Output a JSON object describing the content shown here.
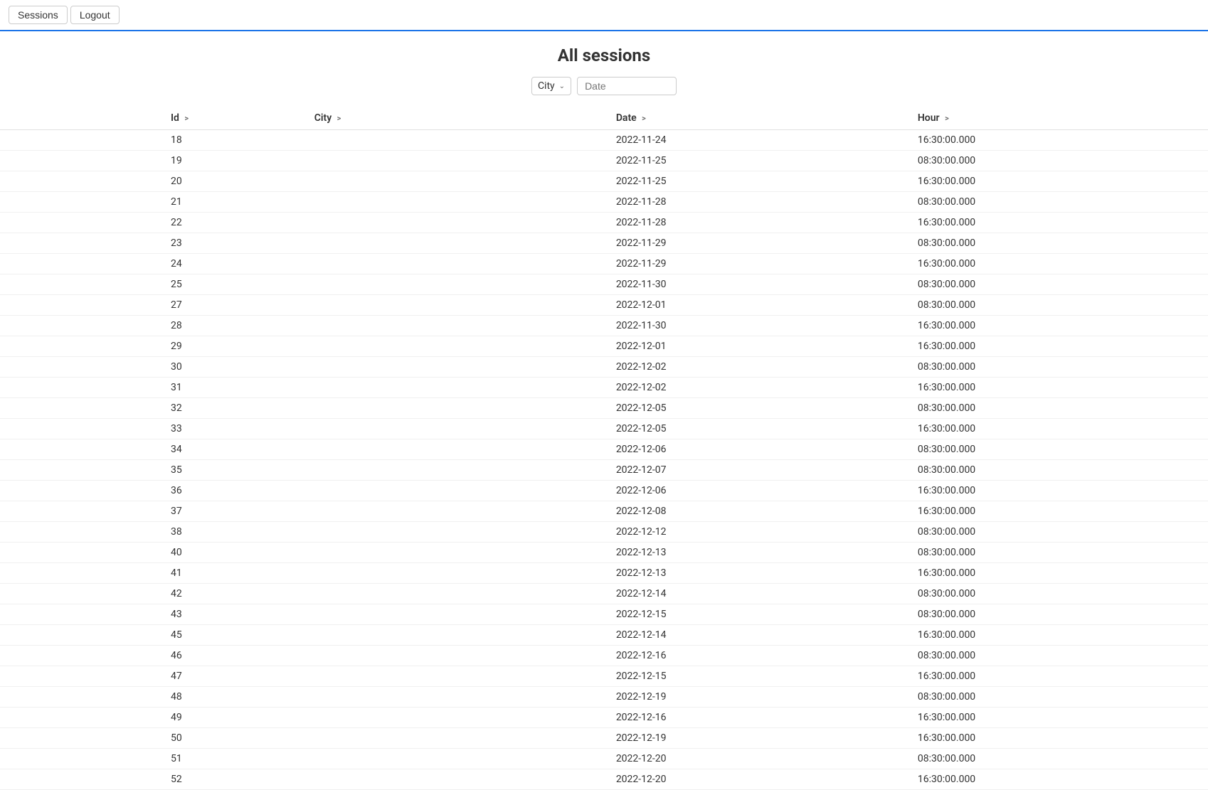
{
  "nav": {
    "sessions_label": "Sessions",
    "logout_label": "Logout"
  },
  "page": {
    "title": "All sessions"
  },
  "filters": {
    "city_label": "City",
    "date_placeholder": "Date"
  },
  "table": {
    "columns": [
      {
        "key": "id",
        "label": "Id",
        "sort": ">"
      },
      {
        "key": "city",
        "label": "City",
        "sort": ">"
      },
      {
        "key": "date",
        "label": "Date",
        "sort": ">"
      },
      {
        "key": "hour",
        "label": "Hour",
        "sort": ">"
      }
    ],
    "rows": [
      {
        "id": "18",
        "city": "",
        "date": "2022-11-24",
        "hour": "16:30:00.000"
      },
      {
        "id": "19",
        "city": "",
        "date": "2022-11-25",
        "hour": "08:30:00.000"
      },
      {
        "id": "20",
        "city": "",
        "date": "2022-11-25",
        "hour": "16:30:00.000"
      },
      {
        "id": "21",
        "city": "",
        "date": "2022-11-28",
        "hour": "08:30:00.000"
      },
      {
        "id": "22",
        "city": "",
        "date": "2022-11-28",
        "hour": "16:30:00.000"
      },
      {
        "id": "23",
        "city": "",
        "date": "2022-11-29",
        "hour": "08:30:00.000"
      },
      {
        "id": "24",
        "city": "",
        "date": "2022-11-29",
        "hour": "16:30:00.000"
      },
      {
        "id": "25",
        "city": "",
        "date": "2022-11-30",
        "hour": "08:30:00.000"
      },
      {
        "id": "27",
        "city": "",
        "date": "2022-12-01",
        "hour": "08:30:00.000"
      },
      {
        "id": "28",
        "city": "",
        "date": "2022-11-30",
        "hour": "16:30:00.000"
      },
      {
        "id": "29",
        "city": "",
        "date": "2022-12-01",
        "hour": "16:30:00.000"
      },
      {
        "id": "30",
        "city": "",
        "date": "2022-12-02",
        "hour": "08:30:00.000"
      },
      {
        "id": "31",
        "city": "",
        "date": "2022-12-02",
        "hour": "16:30:00.000"
      },
      {
        "id": "32",
        "city": "",
        "date": "2022-12-05",
        "hour": "08:30:00.000"
      },
      {
        "id": "33",
        "city": "",
        "date": "2022-12-05",
        "hour": "16:30:00.000"
      },
      {
        "id": "34",
        "city": "",
        "date": "2022-12-06",
        "hour": "08:30:00.000"
      },
      {
        "id": "35",
        "city": "",
        "date": "2022-12-07",
        "hour": "08:30:00.000"
      },
      {
        "id": "36",
        "city": "",
        "date": "2022-12-06",
        "hour": "16:30:00.000"
      },
      {
        "id": "37",
        "city": "",
        "date": "2022-12-08",
        "hour": "16:30:00.000"
      },
      {
        "id": "38",
        "city": "",
        "date": "2022-12-12",
        "hour": "08:30:00.000"
      },
      {
        "id": "40",
        "city": "",
        "date": "2022-12-13",
        "hour": "08:30:00.000"
      },
      {
        "id": "41",
        "city": "",
        "date": "2022-12-13",
        "hour": "16:30:00.000"
      },
      {
        "id": "42",
        "city": "",
        "date": "2022-12-14",
        "hour": "08:30:00.000"
      },
      {
        "id": "43",
        "city": "",
        "date": "2022-12-15",
        "hour": "08:30:00.000"
      },
      {
        "id": "45",
        "city": "",
        "date": "2022-12-14",
        "hour": "16:30:00.000"
      },
      {
        "id": "46",
        "city": "",
        "date": "2022-12-16",
        "hour": "08:30:00.000"
      },
      {
        "id": "47",
        "city": "",
        "date": "2022-12-15",
        "hour": "16:30:00.000"
      },
      {
        "id": "48",
        "city": "",
        "date": "2022-12-19",
        "hour": "08:30:00.000"
      },
      {
        "id": "49",
        "city": "",
        "date": "2022-12-16",
        "hour": "16:30:00.000"
      },
      {
        "id": "50",
        "city": "",
        "date": "2022-12-19",
        "hour": "16:30:00.000"
      },
      {
        "id": "51",
        "city": "",
        "date": "2022-12-20",
        "hour": "08:30:00.000"
      },
      {
        "id": "52",
        "city": "",
        "date": "2022-12-20",
        "hour": "16:30:00.000"
      }
    ]
  }
}
